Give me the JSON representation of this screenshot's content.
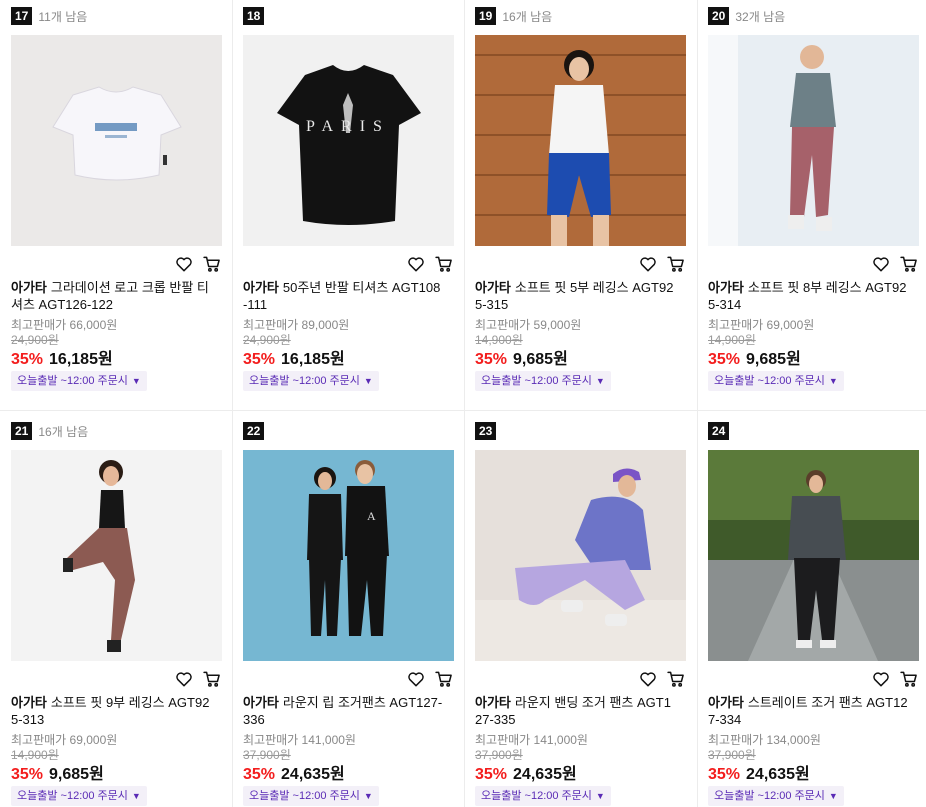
{
  "labels": {
    "max_price_prefix": "최고판매가",
    "shipping_badge": "오늘출발 ~12:00 주문시",
    "shipping_toggle": "▼"
  },
  "products": [
    {
      "rank": "17",
      "remaining": "11개 남음",
      "brand": "아가타",
      "name": "그라데이션 로고 크롭 반팔 티셔츠 AGT126-122",
      "max_price": "66,000원",
      "original_price": "24,900원",
      "discount": "35%",
      "price": "16,185원",
      "image": "white-crop-tee"
    },
    {
      "rank": "18",
      "remaining": "",
      "brand": "아가타",
      "name": "50주년 반팔 티셔츠 AGT108-111",
      "max_price": "89,000원",
      "original_price": "24,900원",
      "discount": "35%",
      "price": "16,185원",
      "image": "black-paris-tee"
    },
    {
      "rank": "19",
      "remaining": "16개 남음",
      "brand": "아가타",
      "name": "소프트 핏 5부 레깅스 AGT925-315",
      "max_price": "59,000원",
      "original_price": "14,900원",
      "discount": "35%",
      "price": "9,685원",
      "image": "blue-5-leggings"
    },
    {
      "rank": "20",
      "remaining": "32개 남음",
      "brand": "아가타",
      "name": "소프트 핏 8부 레깅스 AGT925-314",
      "max_price": "69,000원",
      "original_price": "14,900원",
      "discount": "35%",
      "price": "9,685원",
      "image": "rose-8-leggings"
    },
    {
      "rank": "21",
      "remaining": "16개 남음",
      "brand": "아가타",
      "name": "소프트 핏 9부 레깅스 AGT925-313",
      "max_price": "69,000원",
      "original_price": "14,900원",
      "discount": "35%",
      "price": "9,685원",
      "image": "brown-9-leggings"
    },
    {
      "rank": "22",
      "remaining": "",
      "brand": "아가타",
      "name": "라운지 립 조거팬츠 AGT127-336",
      "max_price": "141,000원",
      "original_price": "37,900원",
      "discount": "35%",
      "price": "24,635원",
      "image": "black-jogger-couple"
    },
    {
      "rank": "23",
      "remaining": "",
      "brand": "아가타",
      "name": "라운지 밴딩 조거 팬츠 AGT127-335",
      "max_price": "141,000원",
      "original_price": "37,900원",
      "discount": "35%",
      "price": "24,635원",
      "image": "purple-jogger"
    },
    {
      "rank": "24",
      "remaining": "",
      "brand": "아가타",
      "name": "스트레이트 조거 팬츠 AGT127-334",
      "max_price": "134,000원",
      "original_price": "37,900원",
      "discount": "35%",
      "price": "24,635원",
      "image": "gray-jogger-park"
    }
  ],
  "colors": {
    "discount": "#f31d1d",
    "shipping_text": "#5a2bb5",
    "shipping_bg": "#f3f0f8",
    "rank_bg": "#111111"
  }
}
